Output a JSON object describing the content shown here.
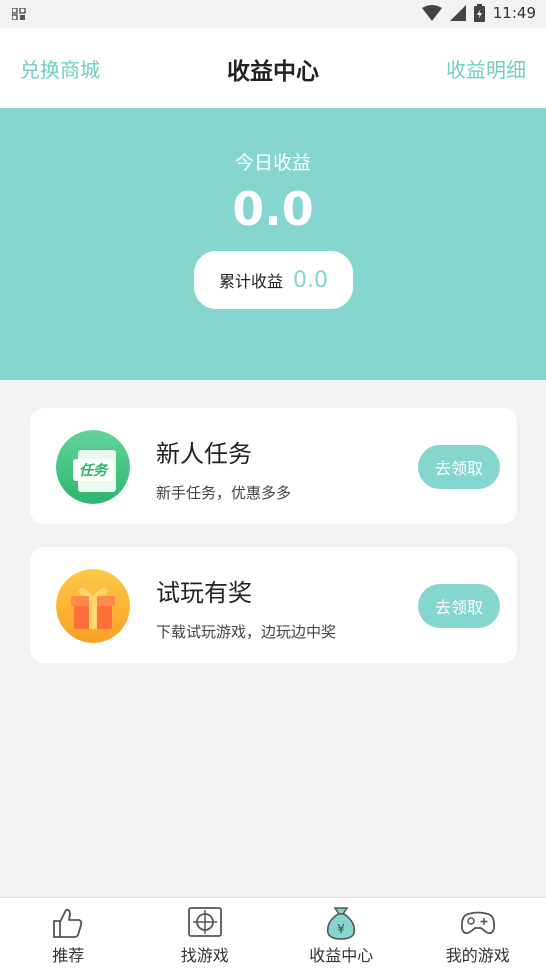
{
  "status_bar": {
    "time": "11:49"
  },
  "header": {
    "left_link": "兑换商城",
    "title": "收益中心",
    "right_link": "收益明细"
  },
  "earnings": {
    "today_label": "今日收益",
    "today_value": "0.0",
    "total_label": "累计收益",
    "total_value": "0.0"
  },
  "tasks": [
    {
      "title": "新人任务",
      "subtitle": "新手任务，优惠多多",
      "button": "去领取",
      "icon": "task-icon",
      "icon_text": "任务"
    },
    {
      "title": "试玩有奖",
      "subtitle": "下载试玩游戏，边玩边中奖",
      "button": "去领取",
      "icon": "gift-icon"
    }
  ],
  "tabbar": {
    "items": [
      {
        "label": "推荐",
        "icon": "thumbs-up-icon"
      },
      {
        "label": "找游戏",
        "icon": "target-icon"
      },
      {
        "label": "收益中心",
        "icon": "money-bag-icon"
      },
      {
        "label": "我的游戏",
        "icon": "gamepad-icon"
      }
    ]
  },
  "colors": {
    "accent": "#85d6cf",
    "link": "#6ed0c4"
  }
}
